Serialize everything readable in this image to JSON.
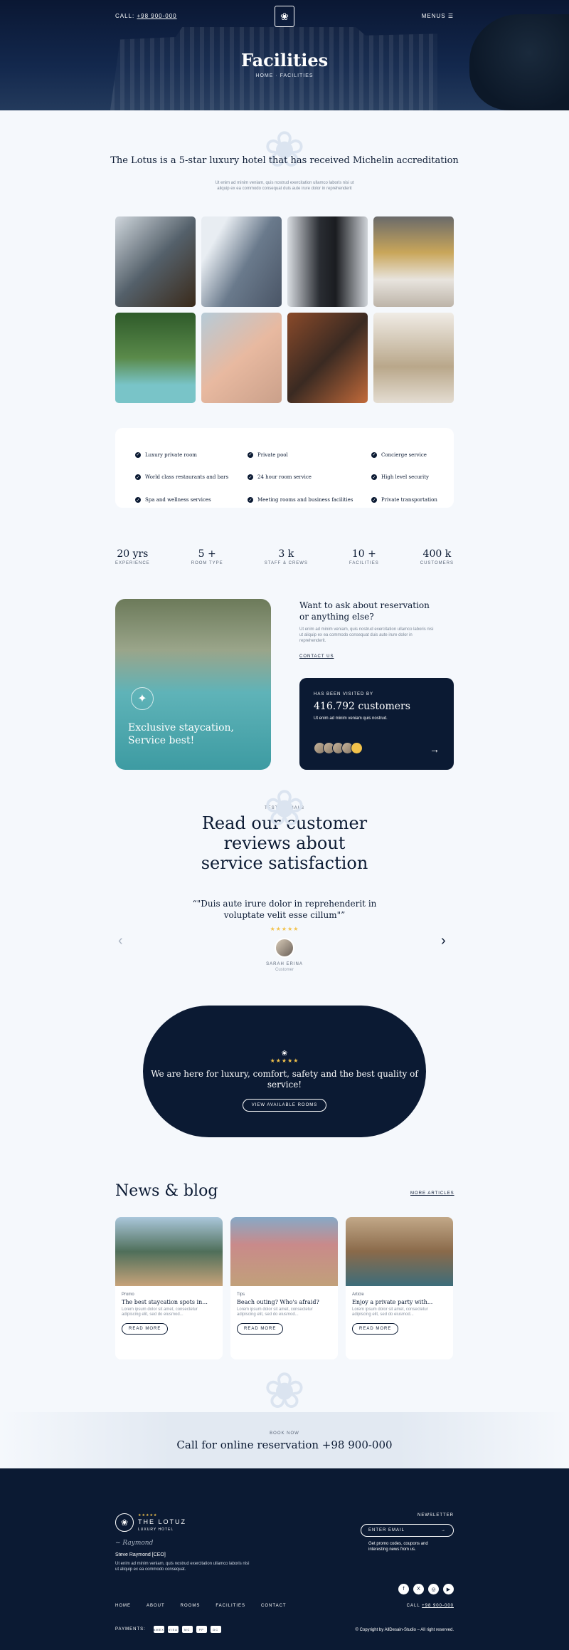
{
  "header": {
    "call_label": "CALL:",
    "call_number": "+98 900-000",
    "menus_label": "MENUS",
    "menus_icon": "menu-icon",
    "title": "Facilities",
    "breadcrumb": "HOME · FACILITIES"
  },
  "intro": {
    "heading": "The Lotus is a 5-star luxury hotel that has received Michelin accreditation",
    "text": "Ut enim ad minim veniam, quis nostrud exercitation ullamco laboris nisi ut aliquip ex ea commodo consequat duis aute irure dolor in reprehenderit"
  },
  "features": [
    "Luxury private room",
    "Private pool",
    "Concierge service",
    "World class restaurants and bars",
    "24 hour room service",
    "High level security",
    "Spa and wellness services",
    "Meeting rooms and business facilities",
    "Private transportation"
  ],
  "stats": [
    {
      "value": "20 yrs",
      "label": "EXPERIENCE"
    },
    {
      "value": "5 +",
      "label": "ROOM TYPE"
    },
    {
      "value": "3 k",
      "label": "STAFF & CREWS"
    },
    {
      "value": "10 +",
      "label": "FACILITIES"
    },
    {
      "value": "400 k",
      "label": "CUSTOMERS"
    }
  ],
  "staycation": {
    "title": "Exclusive staycation, Service best!"
  },
  "ask": {
    "heading": "Want to ask about reservation or anything else?",
    "text": "Ut enim ad minim veniam, quis nostrud exercitation ullamco laboris nisi ut aliquip ex ea commodo consequat duis aute irure dolor in reprehenderit.",
    "link": "CONTACT US"
  },
  "visited": {
    "kicker": "HAS BEEN VISITED BY",
    "count": "416.792 customers",
    "text": "Ut enim ad minim veniam quis nostrud."
  },
  "testimonials": {
    "kicker": "TESTIMONIALS",
    "heading": "Read our customer reviews about service satisfaction",
    "quote": "\"Duis aute irure dolor in reprehenderit in voluptate velit esse cillum\"",
    "stars": "★★★★★",
    "name": "SARAH ERINA",
    "role": "Customer"
  },
  "cta": {
    "stars": "★★★★★",
    "heading": "We are here for luxury, comfort, safety and the best quality of service!",
    "button": "VIEW AVAILABLE ROOMS"
  },
  "blog": {
    "heading": "News & blog",
    "more": "MORE ARTICLES",
    "cards": [
      {
        "category": "Promo",
        "title": "The best staycation spots in...",
        "text": "Lorem ipsum dolor sit amet, consectetur adipiscing elit, sed do eiusmod...",
        "button": "READ MORE"
      },
      {
        "category": "Tips",
        "title": "Beach outing? Who's afraid?",
        "text": "Lorem ipsum dolor sit amet, consectetur adipiscing elit, sed do eiusmod...",
        "button": "READ MORE"
      },
      {
        "category": "Article",
        "title": "Enjoy a private party with...",
        "text": "Lorem ipsum dolor sit amet, consectetur adipiscing elit, sed do eiusmod...",
        "button": "READ MORE"
      }
    ]
  },
  "book": {
    "kicker": "BOOK NOW",
    "text": "Call for online reservation +98 900-000"
  },
  "footer": {
    "stars": "★★★★★",
    "brand": "THE LOTUZ",
    "brand_sub": "LUXURY HOTEL",
    "name": "Steve Raymond [CEO]",
    "desc": "Ut enim ad minim veniam, quis nostrud exercitation ullamco laboris nisi ut aliquip ex ea commodo consequat.",
    "newsletter": "NEWSLETTER",
    "email_placeholder": "ENTER EMAIL",
    "newsletter_note": "Get promo codes, coupons and interesting news from us.",
    "nav": [
      "HOME",
      "ABOUT",
      "ROOMS",
      "FACILITIES",
      "CONTACT"
    ],
    "call_label": "CALL",
    "call_number": "+98 900-000",
    "payments_label": "PAYMENTS:",
    "payments": [
      "AMEX",
      "VISA",
      "MC",
      "PP",
      "DC"
    ],
    "copyright": "© Copyright by AllDesain-Studio – All right reserved."
  },
  "colors": {
    "navy": "#0b1a33",
    "gold": "#f2c24b",
    "bg": "#f5f8fc"
  }
}
